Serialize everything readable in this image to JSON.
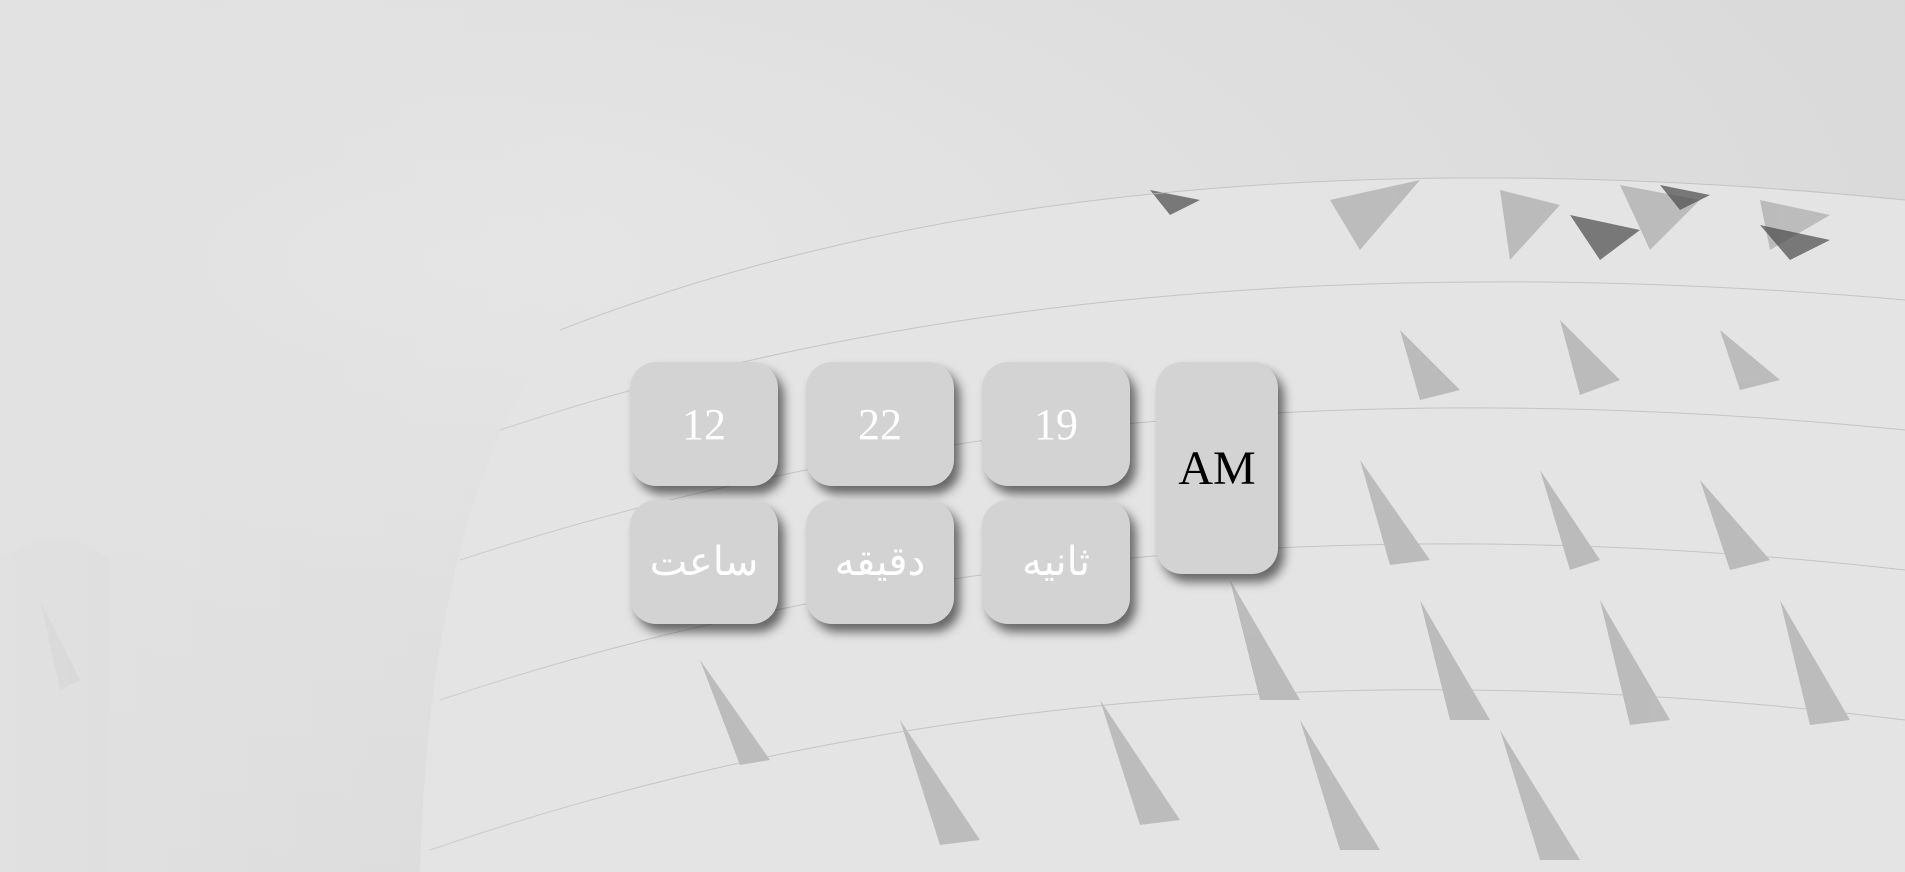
{
  "clock": {
    "hours": "12",
    "minutes": "22",
    "seconds": "19",
    "period": "AM",
    "hours_label": "ساعت",
    "minutes_label": "دقیقه",
    "seconds_label": "ثانیه"
  },
  "colors": {
    "tile_background": "#d3d3d3",
    "tile_text": "#ffffff",
    "period_text": "#000000",
    "page_background": "#dcdcdc"
  }
}
